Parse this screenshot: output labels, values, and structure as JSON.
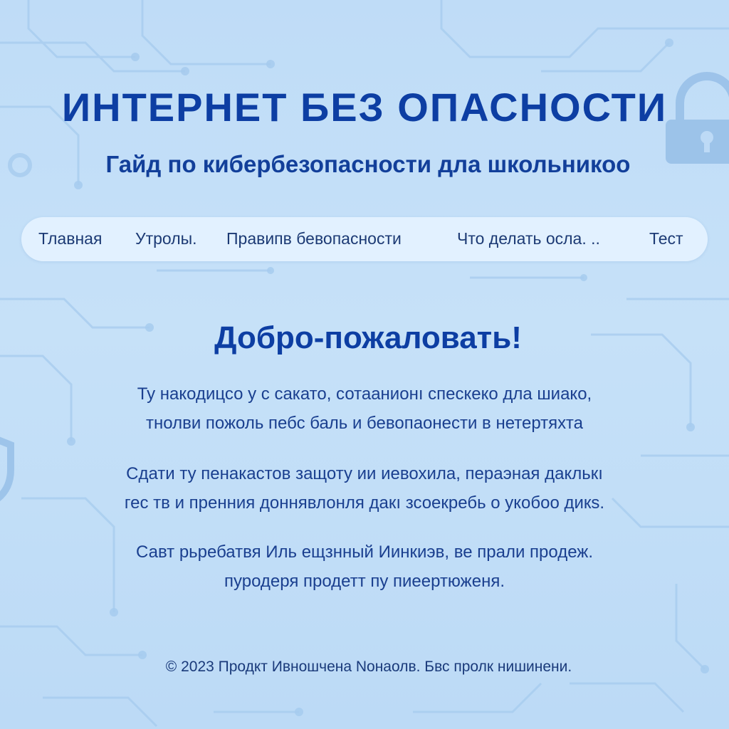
{
  "header": {
    "title": "ИНТЕРНЕТ БЕЗ ОПАСНОСТИ",
    "subtitle": "Гайд по кибербезопасности дла школьникоо"
  },
  "nav": {
    "items": [
      {
        "label": "Тлавная"
      },
      {
        "label": "Утролы."
      },
      {
        "label": "Правипв бевопасности"
      },
      {
        "label": "Что делать  осла. .."
      },
      {
        "label": "Тест"
      }
    ]
  },
  "main": {
    "heading": "Добро-пожаловать!",
    "paragraphs": [
      {
        "lines": [
          "Ту накодицсо у с сакато, сотаанионı спескеко дла шиако,",
          "тнолви пожоль пебс баль и бевопаонести в нетертяхта"
        ]
      },
      {
        "lines": [
          "Сдати ту пенакастов защоту ии иевохила, пераэная даклькı",
          "гес тв и пренния доннявлонля дакı зсоекребь о укобоо дикs."
        ]
      },
      {
        "lines": [
          "Савт рьребатвя Иль ещзнный Иинкиэв, ве прали продеж.",
          "пуродеря продетт пу пиеертюженя."
        ]
      }
    ]
  },
  "footer": {
    "text": "© 2023 Продкт Ивношчена Nонаолв. Бвс пролк нишинени."
  },
  "colors": {
    "background": "#c4e0f8",
    "title": "#0d3ea3",
    "text": "#1a3f8f",
    "nav_bg": "#e4f2ff",
    "decor": "#9fc6ec"
  },
  "icons": [
    "padlock-icon",
    "shield-icon",
    "circuit-pattern"
  ]
}
